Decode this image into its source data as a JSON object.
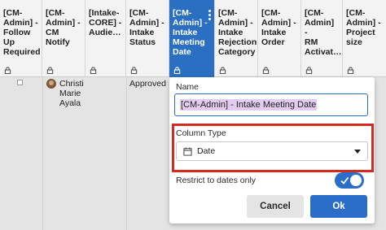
{
  "columns": [
    {
      "label": "[CM-\nAdmin] -\nFollow\nUp\nRequired"
    },
    {
      "label": "[CM-\nAdmin] -\nCM\nNotify"
    },
    {
      "label": "[Intake-\nCORE] -\nAudie…"
    },
    {
      "label": "[CM-\nAdmin] -\nIntake\nStatus"
    },
    {
      "label": "[CM-\nAdmin] -\nIntake\nMeeting\nDate"
    },
    {
      "label": "[CM-\nAdmin] -\nIntake\nRejection\nCategory"
    },
    {
      "label": "[CM-\nAdmin] -\nIntake\nOrder"
    },
    {
      "label": "[CM-\nAdmin] -\nRM\nActivat…"
    },
    {
      "label": "[CM-\nAdmin] -\nProject\nsize"
    }
  ],
  "row": {
    "name": "Christi\nMarie\nAyala",
    "status": "Approved"
  },
  "popup": {
    "name_label": "Name",
    "name_value": "[CM-Admin] - Intake Meeting Date",
    "column_type_label": "Column Type",
    "column_type_value": "Date",
    "restrict_label": "Restrict to dates only",
    "restrict_enabled": true,
    "cancel_label": "Cancel",
    "ok_label": "Ok"
  },
  "colors": {
    "accent": "#2a6ec9",
    "highlight": "#d42a1f",
    "selection": "#e3ccef"
  }
}
